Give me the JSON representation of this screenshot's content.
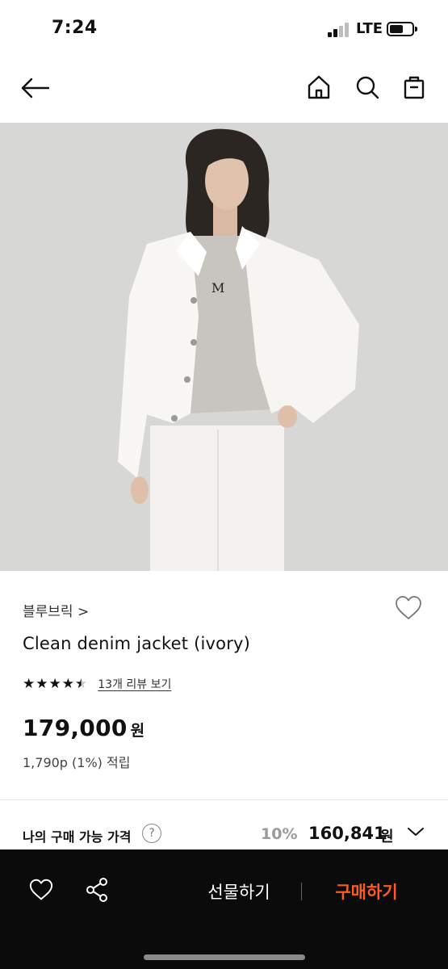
{
  "status_bar": {
    "time": "7:24",
    "network": "LTE",
    "battery_icon": "battery-icon",
    "signal_icon": "signal-icon"
  },
  "nav": {
    "back_icon": "arrow-left-icon",
    "home_icon": "home-icon",
    "search_icon": "search-icon",
    "bag_icon": "shopping-bag-icon"
  },
  "product": {
    "image_icon": "product-photo",
    "brand": "블루브릭 >",
    "name": "Clean denim jacket (ivory)",
    "rating_stars": 4.5,
    "rating_max": 5,
    "review_link": "13개 리뷰 보기",
    "price": "179,000",
    "currency": "원",
    "points": "1,790p (1%) 적립"
  },
  "my_price": {
    "label": "나의 구매 가능 가격",
    "help": "?",
    "discount": "10%",
    "price": "160,841",
    "currency": "원"
  },
  "bottom_bar": {
    "gift_label": "선물하기",
    "buy_label": "구매하기",
    "buy_color": "#ff5a1f",
    "wish_icon": "heart-icon",
    "share_icon": "share-icon"
  },
  "colors": {
    "background": "#ffffff",
    "bottom_bar": "#0b0b0b",
    "accent": "#ff5a1f"
  }
}
